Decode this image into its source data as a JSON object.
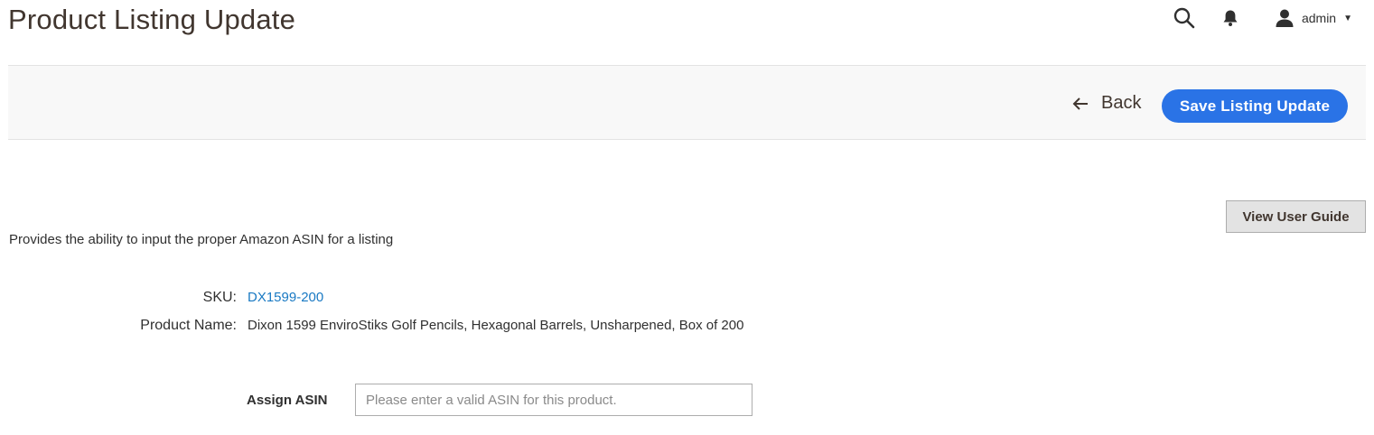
{
  "page": {
    "title": "Product Listing Update"
  },
  "header": {
    "search_icon": "search-icon",
    "notifications_icon": "bell-icon",
    "user_icon": "user-icon",
    "user_name": "admin"
  },
  "action_bar": {
    "back_label": "Back",
    "save_label": "Save Listing Update"
  },
  "content": {
    "guide_button_label": "View User Guide",
    "description": "Provides the ability to input the proper Amazon ASIN for a listing",
    "sku_label": "SKU:",
    "sku_value": "DX1599-200",
    "product_name_label": "Product Name:",
    "product_name_value": "Dixon 1599 EnviroStiks Golf Pencils, Hexagonal Barrels, Unsharpened, Box of 200",
    "asin_label": "Assign ASIN",
    "asin_value": "",
    "asin_placeholder": "Please enter a valid ASIN for this product."
  },
  "colors": {
    "primary_button": "#2a73e6",
    "link": "#1979c3",
    "title": "#41362f",
    "action_bar_bg": "#f8f8f8"
  }
}
